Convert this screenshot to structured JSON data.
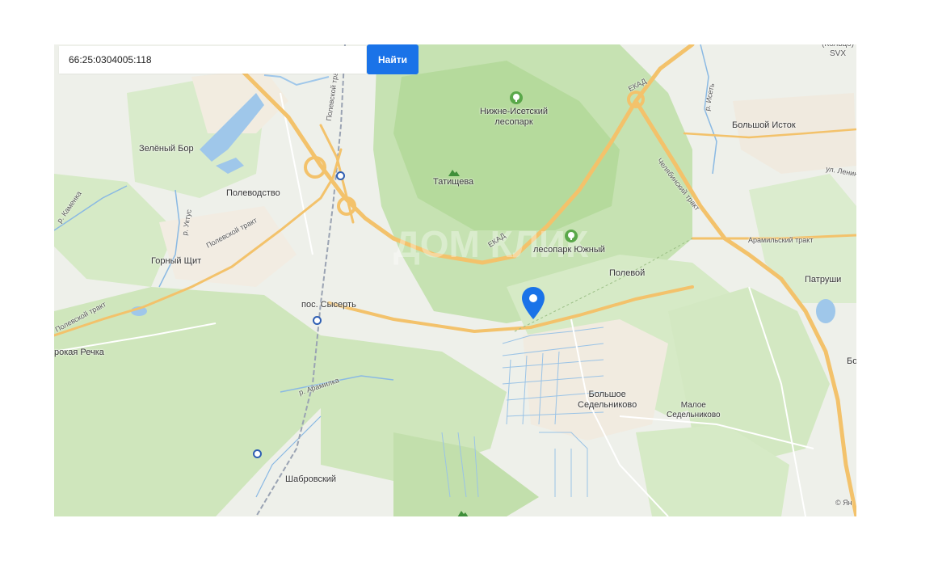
{
  "search": {
    "value": "66:25:0304005:118",
    "button_label": "Найти"
  },
  "map": {
    "copyright": "© Ян",
    "places": {
      "nizhne_isetsky": "Нижне-Исетский\nлесопарк",
      "tatishcheva": "Татищева",
      "park_yuzhny": "лесопарк Южный",
      "zeleny_bor": "Зелёный Бор",
      "polevodstvo": "Полеводство",
      "gorny_shchit": "Горный Щит",
      "pos_sysert": "пос. Сысерть",
      "shirokaya_rechka": "рокая Речка",
      "polevoy": "Полевой",
      "bolshoe_sedelnikovo": "Большое\nСедельниково",
      "maloe_sedelnikovo": "Малое\nСедельниково",
      "shabrovsky": "Шабровский",
      "bolshoy_istok": "Большой Исток",
      "patrushi": "Патруши",
      "bo": "Бо",
      "svx": "(Кольцо)\nSVX"
    },
    "roads": {
      "ekad_top": "ЕКАД",
      "ekad_mid": "ЕКАД",
      "chelyabinsky": "Челябинский тракт",
      "aramilsky": "Арамильский тракт",
      "polevskoy_1": "Полевской тракт",
      "polevskoy_2": "Полевской тракт",
      "polevskoy_3": "Полевской тракт",
      "ul_lenina": "ул. Ленин"
    },
    "rivers": {
      "kamenka": "р. Каменка",
      "uktus": "р. Уктус",
      "aramilka": "р. Арамилка",
      "iset": "р. Исеть"
    },
    "icons": {
      "marker": "location-pin-icon",
      "park": "park-tree-icon",
      "mountain": "mountain-icon",
      "station": "rail-station-icon"
    },
    "colors": {
      "marker": "#1a73e8",
      "button": "#1a73e8",
      "forest": "#c6e2b2",
      "forest_dark": "#a9d58f",
      "road": "#f3c26b",
      "water": "#9fc7ea",
      "land": "#eef0ea"
    }
  }
}
